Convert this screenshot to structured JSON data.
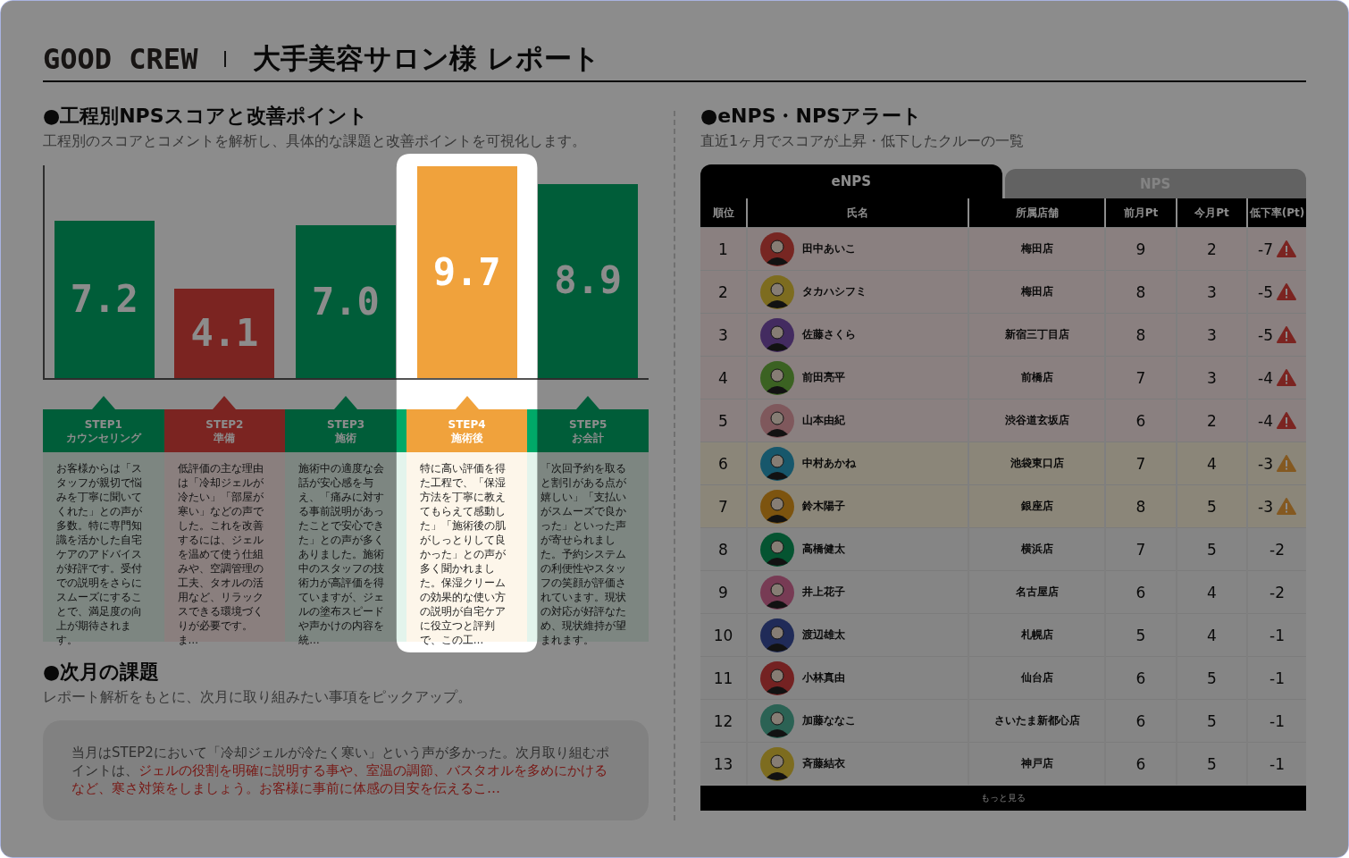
{
  "header": {
    "brand": "GOOD CREW",
    "title": "大手美容サロン様 レポート"
  },
  "process": {
    "heading": "●工程別NPSスコアと改善ポイント",
    "subtitle": "工程別のスコアとコメントを解析し、具体的な課題と改善ポイントを可視化します。",
    "steps": [
      {
        "score": "7.2",
        "level": 0.72,
        "label": "STEP1",
        "sub": "カウンセリング",
        "kind": "good",
        "selected": false,
        "text": "お客様からは「スタッフが親切で悩みを丁寧に聞いてくれた」との声が多数。特に専門知識を活かした自宅ケアのアドバイスが好評です。受付での説明をさらにスムーズにすることで、満足度の向上が期待されます。"
      },
      {
        "score": "4.1",
        "level": 0.41,
        "label": "STEP2",
        "sub": "準備",
        "kind": "bad",
        "selected": false,
        "text": "低評価の主な理由は「冷却ジェルが冷たい」「部屋が寒い」などの声でした。これを改善するには、ジェルを温めて使う仕組みや、空調管理の工夫、タオルの活用など、リラックスできる環境づくりが必要です。ま…"
      },
      {
        "score": "7.0",
        "level": 0.7,
        "label": "STEP3",
        "sub": "施術",
        "kind": "good",
        "selected": false,
        "text": "施術中の適度な会話が安心感を与え、「痛みに対する事前説明があったことで安心できた」との声が多くありました。施術中のスタッフの技術力が高評価を得ていますが、ジェルの塗布スピードや声かけの内容を統…"
      },
      {
        "score": "9.7",
        "level": 0.97,
        "label": "STEP4",
        "sub": "施術後",
        "kind": "best",
        "selected": true,
        "text": "特に高い評価を得た工程で、「保湿方法を丁寧に教えてもらえて感動した」「施術後の肌がしっとりして良かった」との声が多く聞かれました。保湿クリームの効果的な使い方の説明が自宅ケアに役立つと評判で、この工…"
      },
      {
        "score": "8.9",
        "level": 0.89,
        "label": "STEP5",
        "sub": "お会計",
        "kind": "good",
        "selected": false,
        "text": "「次回予約を取ると割引がある点が嬉しい」「支払いがスムーズで良かった」といった声が寄せられました。予約システムの利便性やスタッフの笑顔が評価されています。現状の対応が好評なため、現状維持が望まれます。"
      }
    ]
  },
  "next": {
    "heading": "●次月の課題",
    "subtitle": "レポート解析をもとに、次月に取り組みたい事項をピックアップ。",
    "body": [
      {
        "text": "当月はSTEP2において「冷却ジェルが冷たく寒い」という声が多かった。次月取り組むポイントは、",
        "emphasis": false
      },
      {
        "text": "ジェルの役割を明確に説明する事や、室温の調節、バスタオルを多めにかけるなど、寒さ対策をしましょう。お客様に事前に体感の目安を伝えるこ…",
        "emphasis": true
      }
    ]
  },
  "alerts": {
    "heading": "●eNPS・NPSアラート",
    "subtitle": "直近1ヶ月でスコアが上昇・低下したクルーの一覧",
    "tabs": [
      {
        "label": "eNPS",
        "selected": true
      },
      {
        "label": "NPS",
        "selected": false
      }
    ],
    "columns": [
      "順位",
      "氏名",
      "所属店舗",
      "前月Pt",
      "今月Pt",
      "低下率(Pt)"
    ],
    "rows": [
      {
        "rank": "1",
        "name": "田中あいこ",
        "store": "梅田店",
        "prev": "9",
        "curr": "2",
        "drop": "-7",
        "kind": "danger"
      },
      {
        "rank": "2",
        "name": "タカハシフミ",
        "store": "梅田店",
        "prev": "8",
        "curr": "3",
        "drop": "-5",
        "kind": "danger"
      },
      {
        "rank": "3",
        "name": "佐藤さくら",
        "store": "新宿三丁目店",
        "prev": "8",
        "curr": "3",
        "drop": "-5",
        "kind": "danger"
      },
      {
        "rank": "4",
        "name": "前田亮平",
        "store": "前橋店",
        "prev": "7",
        "curr": "3",
        "drop": "-4",
        "kind": "danger"
      },
      {
        "rank": "5",
        "name": "山本由紀",
        "store": "渋谷道玄坂店",
        "prev": "6",
        "curr": "2",
        "drop": "-4",
        "kind": "danger"
      },
      {
        "rank": "6",
        "name": "中村あかね",
        "store": "池袋東口店",
        "prev": "7",
        "curr": "4",
        "drop": "-3",
        "kind": "warning"
      },
      {
        "rank": "7",
        "name": "鈴木陽子",
        "store": "銀座店",
        "prev": "8",
        "curr": "5",
        "drop": "-3",
        "kind": "warning"
      },
      {
        "rank": "8",
        "name": "高橋健太",
        "store": "横浜店",
        "prev": "7",
        "curr": "5",
        "drop": "-2",
        "kind": "normal"
      },
      {
        "rank": "9",
        "name": "井上花子",
        "store": "名古屋店",
        "prev": "6",
        "curr": "4",
        "drop": "-2",
        "kind": "normal"
      },
      {
        "rank": "10",
        "name": "渡辺雄太",
        "store": "札幌店",
        "prev": "5",
        "curr": "4",
        "drop": "-1",
        "kind": "normal"
      },
      {
        "rank": "11",
        "name": "小林真由",
        "store": "仙台店",
        "prev": "6",
        "curr": "5",
        "drop": "-1",
        "kind": "normal"
      },
      {
        "rank": "12",
        "name": "加藤ななこ",
        "store": "さいたま新都心店",
        "prev": "6",
        "curr": "5",
        "drop": "-1",
        "kind": "normal"
      },
      {
        "rank": "13",
        "name": "斉藤結衣",
        "store": "神戸店",
        "prev": "6",
        "curr": "5",
        "drop": "-1",
        "kind": "normal"
      }
    ],
    "more": "もっと見る"
  }
}
